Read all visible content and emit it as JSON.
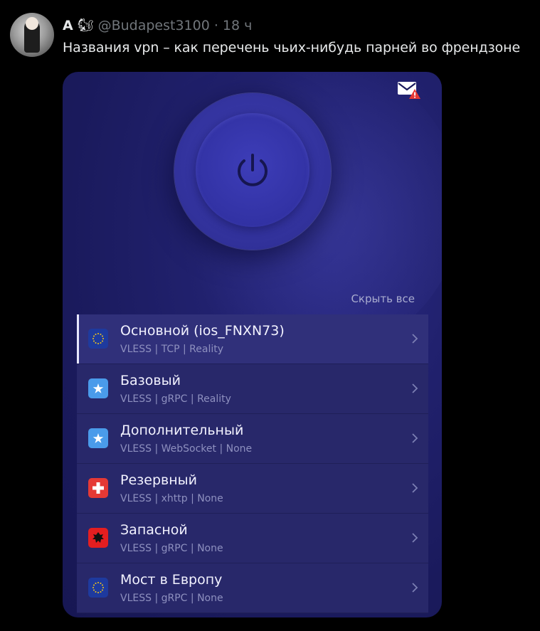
{
  "tweet": {
    "author_name": "А",
    "author_emoji": "🐿",
    "handle": "@Budapest3100",
    "separator": "·",
    "time": "18 ч",
    "text": "Названия vpn – как перечень чьих-нибудь парней во френдзоне"
  },
  "app": {
    "hide_all_label": "Скрыть все",
    "mail_icon": "mail-alert-icon",
    "power_icon": "power-icon",
    "servers": [
      {
        "name": "Основной (ios_FNXN73)",
        "details": "VLESS | TCP | Reality",
        "flag": "eu",
        "active": true
      },
      {
        "name": "Базовый",
        "details": "VLESS | gRPC | Reality",
        "flag": "star-blue"
      },
      {
        "name": "Дополнительный",
        "details": "VLESS | WebSocket | None",
        "flag": "star-blue"
      },
      {
        "name": "Резервный",
        "details": "VLESS | xhttp | None",
        "flag": "swiss"
      },
      {
        "name": "Запасной",
        "details": "VLESS | gRPC | None",
        "flag": "albania"
      },
      {
        "name": "Мост в Европу",
        "details": "VLESS | gRPC | None",
        "flag": "eu"
      }
    ]
  },
  "colors": {
    "background": "#000000",
    "app_bg": "#1a1a5c",
    "row_bg": "#28286a",
    "accent_power": "#3434a0",
    "text_muted": "#71767b"
  }
}
